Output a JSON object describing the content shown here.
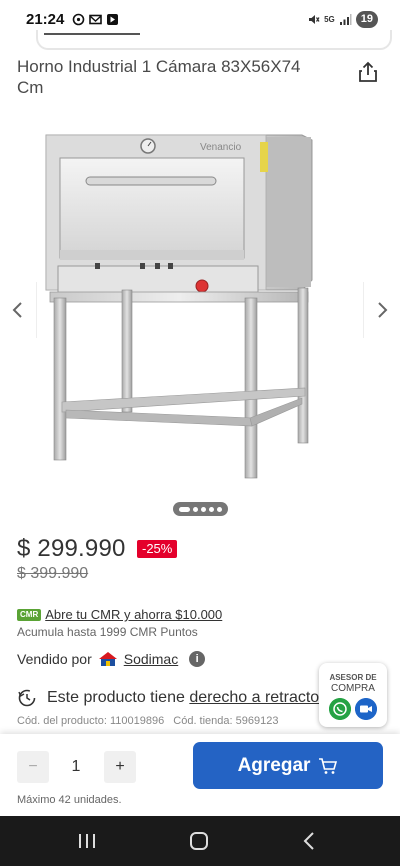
{
  "status_bar": {
    "time": "21:24",
    "battery": "19",
    "network": "5G"
  },
  "product": {
    "title": "Horno Industrial 1 Cámara 83X56X74 Cm",
    "brand_on_image": "Venancio",
    "price": "$ 299.990",
    "discount": "-25%",
    "old_price": "$ 399.990"
  },
  "carousel": {
    "total_images": 5,
    "active_index": 0
  },
  "cmr": {
    "logo_text": "CMR",
    "promo_link": "Abre tu CMR y ahorra $10.000",
    "points": "Acumula hasta 1999 CMR Puntos"
  },
  "seller": {
    "label": "Vendido por",
    "name": "Sodimac",
    "info_icon": "i"
  },
  "retract": {
    "text": "Este producto tiene",
    "link": "derecho a retracto"
  },
  "codes": {
    "product_code": "Cód. del producto: 110019896",
    "store_code": "Cód. tienda: 5969123"
  },
  "asesor": {
    "line1": "ASESOR DE",
    "line2": "COMPRA"
  },
  "cart": {
    "minus": "−",
    "quantity": "1",
    "plus": "+",
    "add_label": "Agregar",
    "max_units": "Máximo 42 unidades."
  },
  "colors": {
    "accent_blue": "#2463c4",
    "discount_red": "#e4002b",
    "cmr_green": "#5aa335"
  }
}
